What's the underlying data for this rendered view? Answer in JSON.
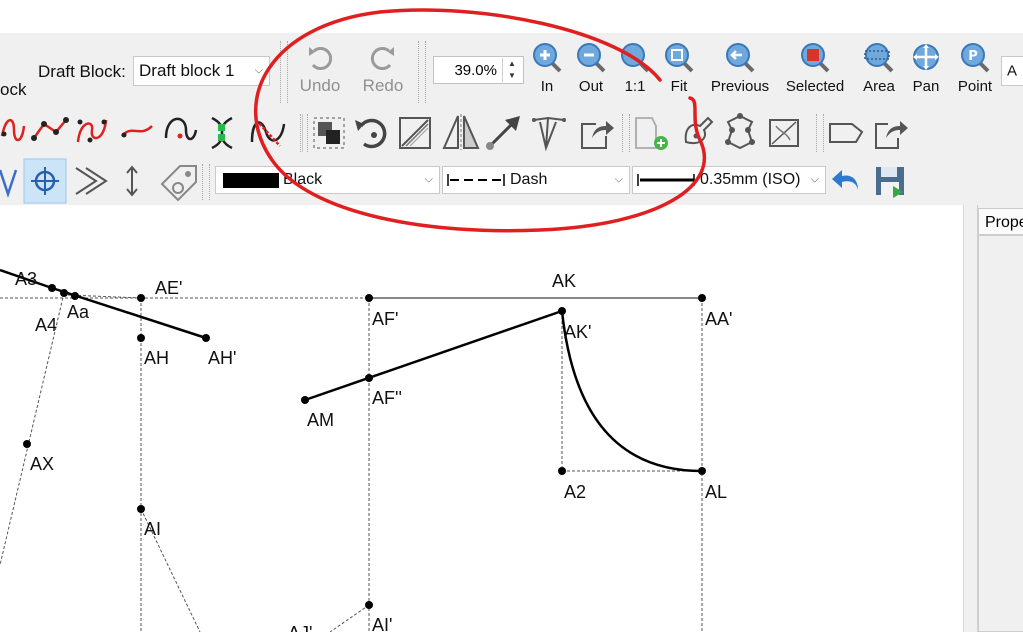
{
  "toolbar": {
    "draft_block_label": "Draft Block:",
    "draft_block_value": "Draft block 1",
    "left_clipped_label": "ock",
    "undo_label": "Undo",
    "redo_label": "Redo",
    "zoom_value": "39.0%",
    "zoom_in_label": "In",
    "zoom_out_label": "Out",
    "zoom_1_1_label": "1:1",
    "zoom_fit_label": "Fit",
    "zoom_previous_label": "Previous",
    "zoom_selected_label": "Selected",
    "zoom_area_label": "Area",
    "pan_label": "Pan",
    "point_label": "Point",
    "right_clipped_text": "A"
  },
  "line_props": {
    "color_name": "Black",
    "line_type": "Dash",
    "line_weight": "0.35mm (ISO)"
  },
  "properties_panel": {
    "title_clipped": "Prope"
  },
  "annotation": {
    "color": "#e02020"
  },
  "drawing": {
    "labels": {
      "A3": "A3",
      "A4": "A4",
      "Aa": "Aa",
      "AE_prime": "AE'",
      "AH": "AH",
      "AH_prime": "AH'",
      "AX": "AX",
      "AI": "AI",
      "AJ_prime": "AJ'",
      "AF_prime": "AF'",
      "AF_dprime": "AF''",
      "AM": "AM",
      "AI_prime": "AI'",
      "AK": "AK",
      "AK_prime": "AK'",
      "AA_prime": "AA'",
      "A2": "A2",
      "AL": "AL"
    }
  }
}
